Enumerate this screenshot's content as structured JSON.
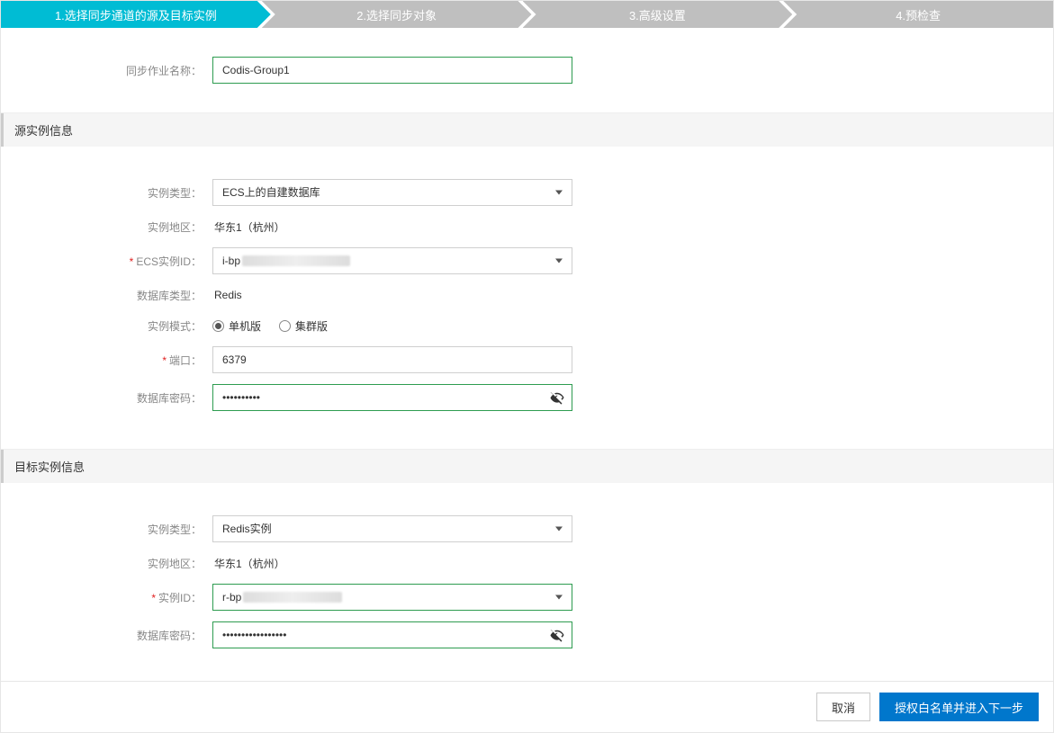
{
  "steps": {
    "s1": "1.选择同步通道的源及目标实例",
    "s2": "2.选择同步对象",
    "s3": "3.高级设置",
    "s4": "4.预检查"
  },
  "top": {
    "sync_job_name_label": "同步作业名称：",
    "sync_job_name_value": "Codis-Group1"
  },
  "source_section": {
    "title": "源实例信息",
    "labels": {
      "instance_type": "实例类型：",
      "instance_region": "实例地区：",
      "ecs_instance_id": "ECS实例ID：",
      "db_type": "数据库类型：",
      "instance_mode": "实例模式：",
      "port": "端口：",
      "db_password": "数据库密码："
    },
    "values": {
      "instance_type": "ECS上的自建数据库",
      "instance_region": "华东1（杭州）",
      "ecs_instance_id_prefix": "i-bp",
      "db_type": "Redis",
      "mode_single": "单机版",
      "mode_cluster": "集群版",
      "mode_selected": "single",
      "port": "6379",
      "db_password_dots": "••••••••••"
    }
  },
  "target_section": {
    "title": "目标实例信息",
    "labels": {
      "instance_type": "实例类型：",
      "instance_region": "实例地区：",
      "instance_id": "实例ID：",
      "db_password": "数据库密码："
    },
    "values": {
      "instance_type": "Redis实例",
      "instance_region": "华东1（杭州）",
      "instance_id_prefix": "r-bp",
      "db_password_dots": "•••••••••••••••••"
    }
  },
  "footer": {
    "cancel": "取消",
    "next": "授权白名单并进入下一步"
  }
}
